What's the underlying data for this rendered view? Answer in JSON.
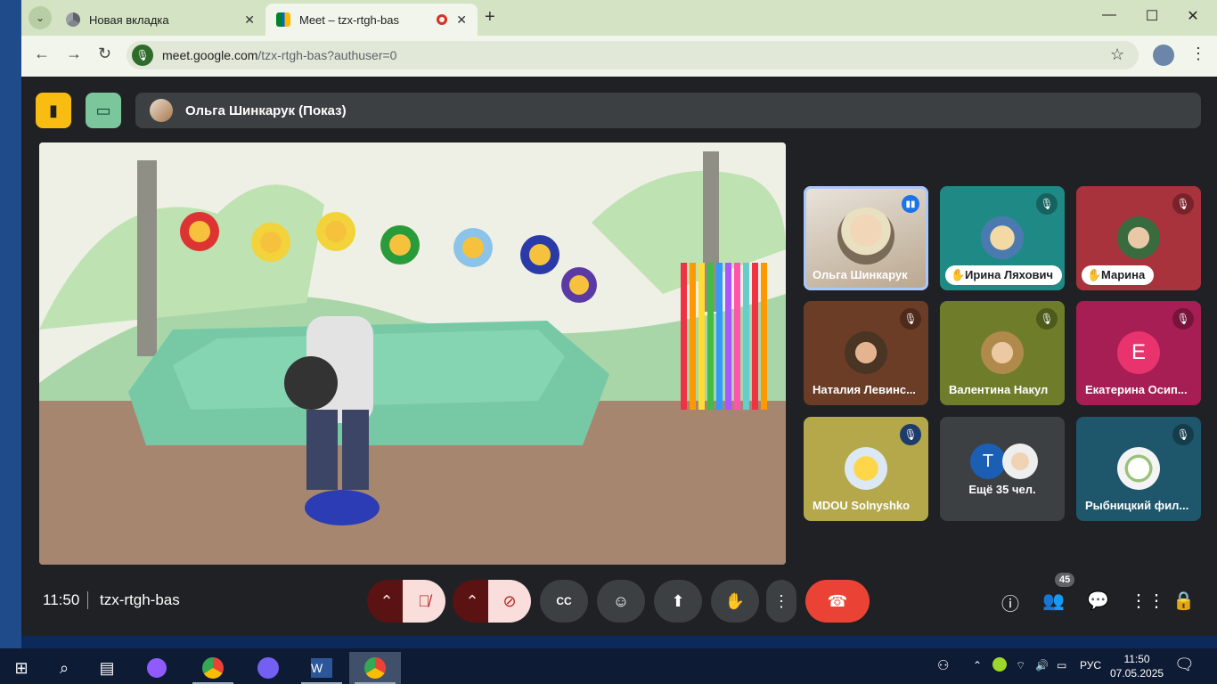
{
  "browser": {
    "tabs": [
      {
        "title": "Новая вкладка",
        "favicon": "chrome-icon"
      },
      {
        "title": "Meet – tzx-rtgh-bas",
        "favicon": "meet-icon",
        "recording": true
      }
    ],
    "url_host": "meet.google.com",
    "url_path": "/tzx-rtgh-bas?authuser=0"
  },
  "meet": {
    "presenter_label": "Ольга Шинкарук (Показ)",
    "time": "11:50",
    "meeting_code": "tzx-rtgh-bas",
    "participants_badge": "45",
    "tiles": [
      {
        "name": "Ольга Шинкарук",
        "state": "speaking",
        "selected": true
      },
      {
        "name": "Ирина Ляхович",
        "state": "muted",
        "hand_raised": true
      },
      {
        "name": "Марина",
        "state": "muted",
        "hand_raised": true
      },
      {
        "name": "Наталия Левинс...",
        "state": "muted"
      },
      {
        "name": "Валентина Накул",
        "state": "muted"
      },
      {
        "name": "Екатерина Осип...",
        "state": "muted",
        "letter": "E"
      },
      {
        "name": "MDOU Solnyshko",
        "state": "muted"
      },
      {
        "name": "Ещё 35 чел.",
        "letter": "T"
      },
      {
        "name": "Рыбницкий фил...",
        "state": "muted"
      }
    ],
    "controls": [
      "microphone-off",
      "camera-off",
      "captions",
      "emoji",
      "present",
      "raise-hand",
      "more",
      "leave-call"
    ],
    "cc_label": "CC"
  },
  "taskbar": {
    "lang": "РУС",
    "time": "11:50",
    "date": "07.05.2025"
  },
  "colors": {
    "accent_yellow": "#f9bd11",
    "leave": "#ea4335",
    "mute_bg": "#f9dedc"
  }
}
